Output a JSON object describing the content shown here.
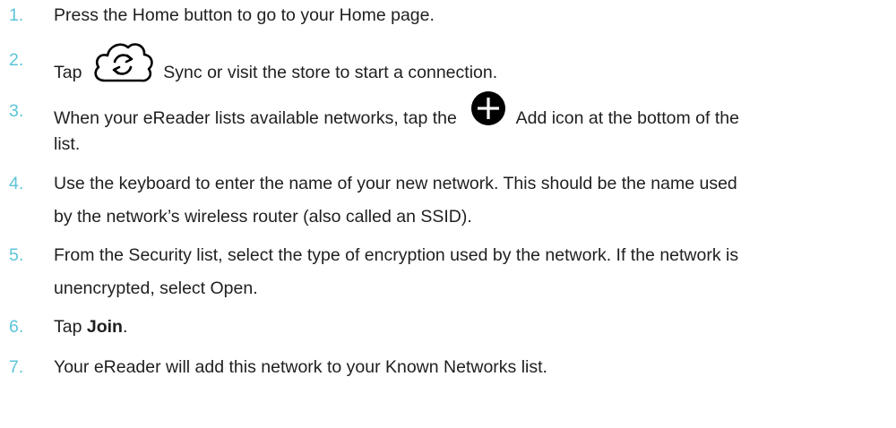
{
  "steps": [
    {
      "num": "1.",
      "text": "Press the Home button to go to your Home page."
    },
    {
      "num": "2.",
      "pre": "Tap",
      "icon": "sync-icon",
      "post": "Sync or visit the store to start a connection."
    },
    {
      "num": "3.",
      "pre": "When your eReader lists available networks, tap the",
      "icon": "add-icon",
      "post": "Add icon at the bottom of the",
      "cont": "list."
    },
    {
      "num": "4.",
      "line1": "Use the keyboard to enter the name of your new network. This should be the name used",
      "line2": "by the network’s wireless router (also called an SSID)."
    },
    {
      "num": "5.",
      "line1": "From the Security list, select the type of encryption used by the network. If the network is",
      "line2": "unencrypted, select Open."
    },
    {
      "num": "6.",
      "pre": "Tap",
      "bold": "Join",
      "post": "."
    },
    {
      "num": "7.",
      "text": "Your eReader will add this network to your Known Networks list."
    }
  ],
  "colors": {
    "number": "#5cc4d8",
    "text": "#1f1f1f"
  }
}
